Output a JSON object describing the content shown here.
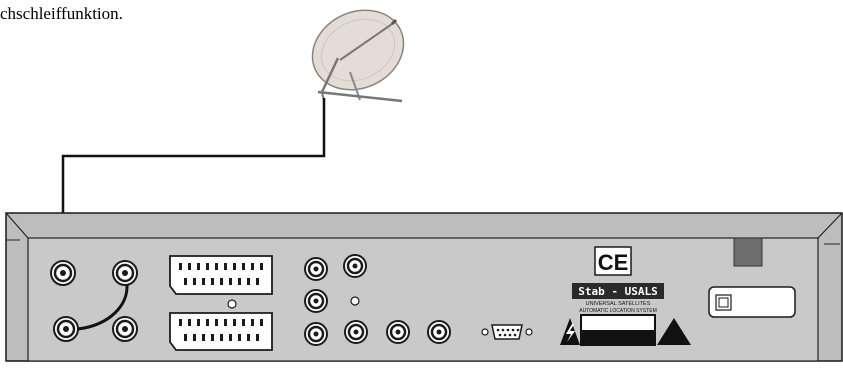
{
  "caption": "chschleiffunktion.",
  "labels": {
    "ce_mark": "CE",
    "brand": "Stab - USALS",
    "brand_sub_line1": "UNIVERSAL SATELLITES",
    "brand_sub_line2": "AUTOMATIC LOCATION SYSTEM"
  },
  "icons": {
    "satellite_dish": "satellite-dish-icon",
    "warning_voltage": "high-voltage-warning-icon",
    "warning_general": "warning-triangle-icon",
    "power_switch": "power-switch-icon"
  },
  "colors": {
    "panel_fill": "#c9c9c9",
    "panel_border": "#1a1a1a",
    "cable": "#111111",
    "power_block": "#6e6e6e",
    "connector_ring": "#1b1b1b"
  }
}
